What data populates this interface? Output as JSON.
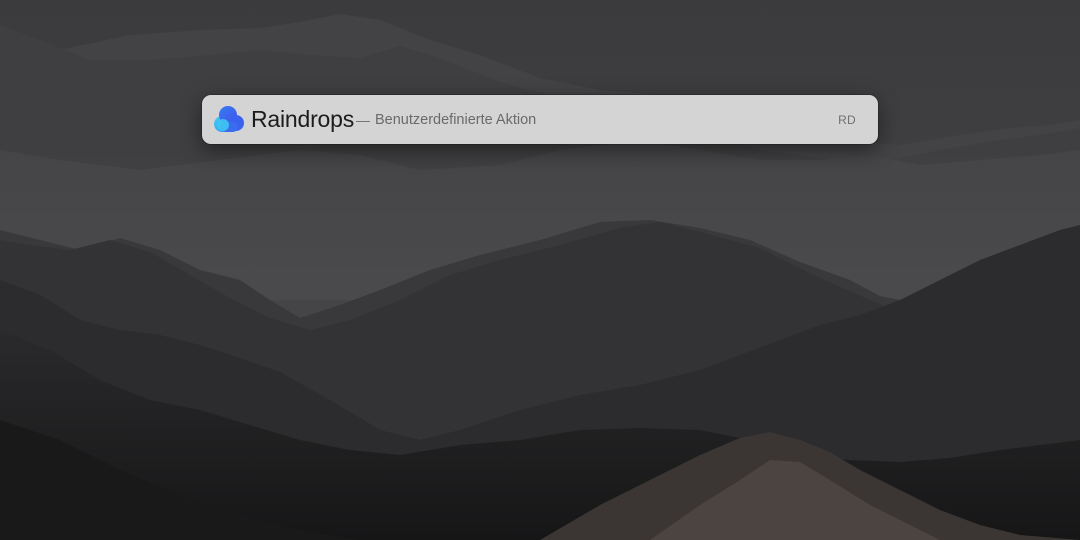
{
  "launcher": {
    "app_icon": "raindrops-cloud-icon",
    "app_name": "Raindrops",
    "separator": "—",
    "action": "Benutzerdefinierte Aktion",
    "shortcut": "RD"
  },
  "wallpaper": {
    "icon": "mountain-landscape",
    "sky_color": "#3a3a3c",
    "ridge_colors": [
      "#4a4a4c",
      "#444446",
      "#3e3e40",
      "#363638",
      "#2e2e30",
      "#262628",
      "#1f1f20"
    ]
  },
  "colors": {
    "launcher_bg": "#d4d4d4",
    "icon_blue": "#2f7cf6",
    "icon_cyan": "#3fc6f2",
    "icon_indigo": "#4b52e8"
  }
}
